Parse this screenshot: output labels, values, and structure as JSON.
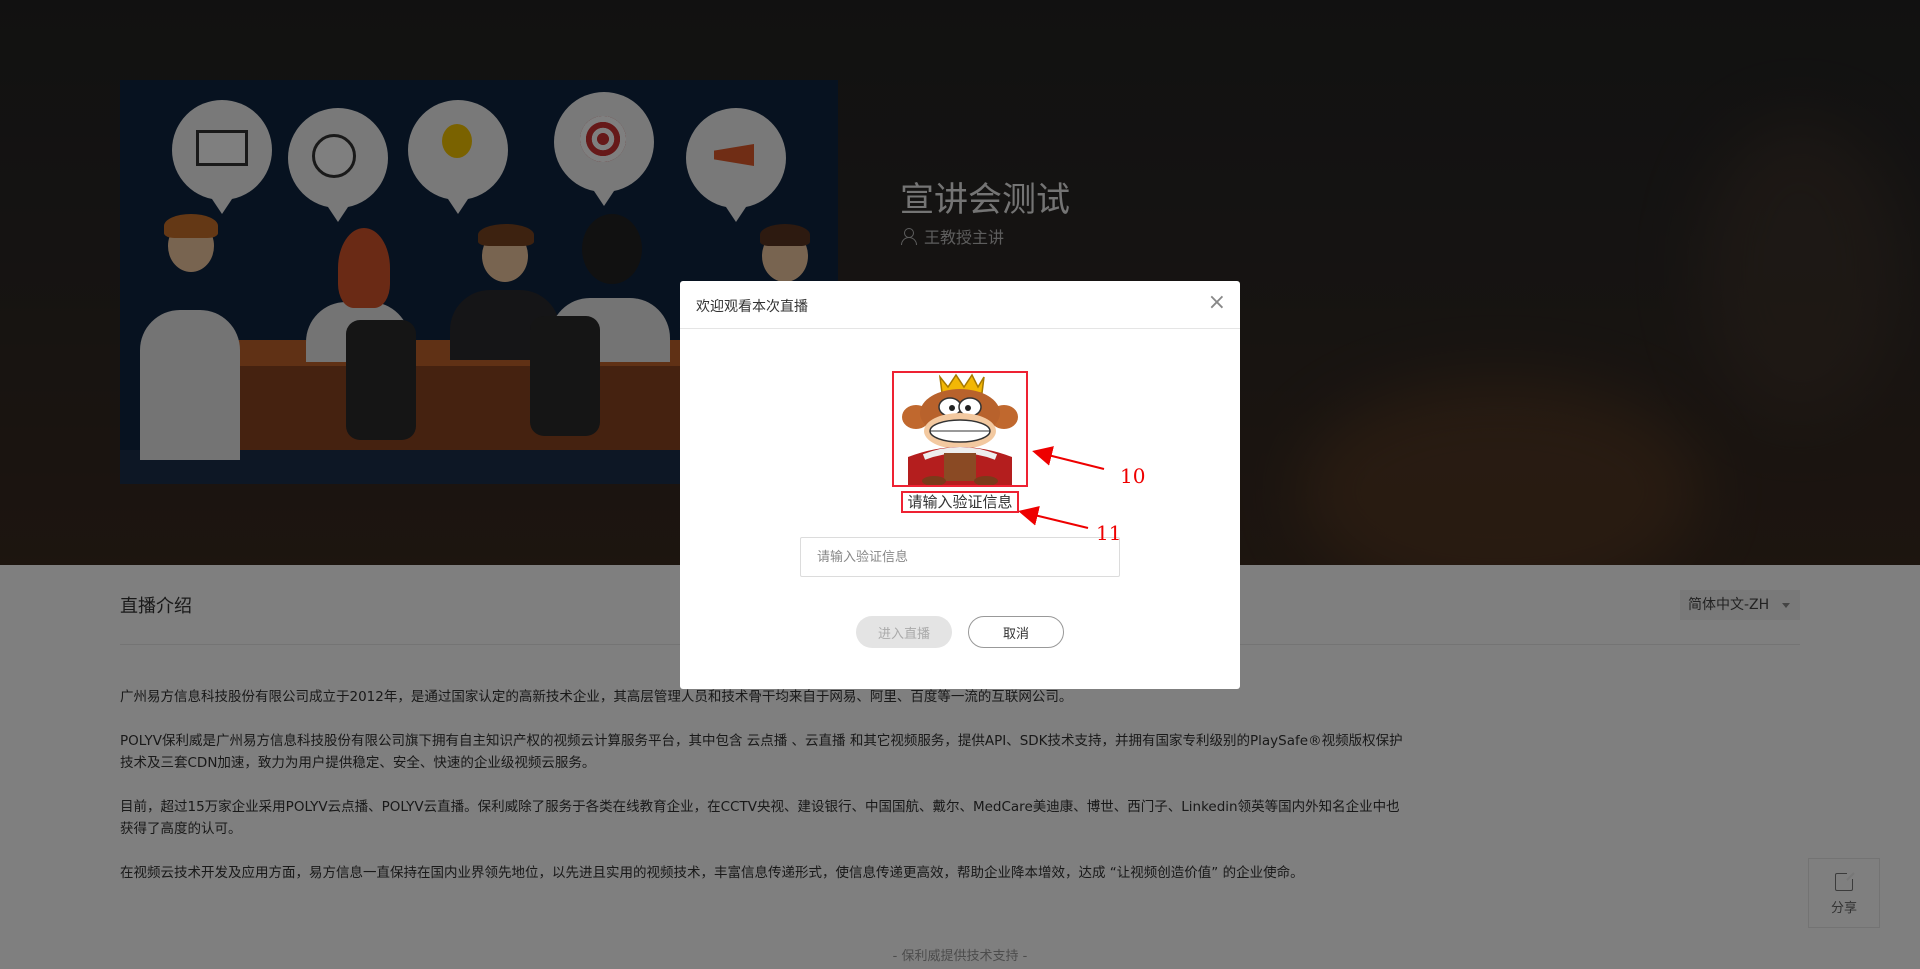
{
  "live": {
    "title": "宣讲会测试",
    "host": "王教授主讲"
  },
  "intro": {
    "section_title": "直播介绍",
    "language": "简体中文-ZH",
    "paragraphs": [
      "广州易方信息科技股份有限公司成立于2012年，是通过国家认定的高新技术企业，其高层管理人员和技术骨干均来自于网易、阿里、百度等一流的互联网公司。",
      "POLYV保利威是广州易方信息科技股份有限公司旗下拥有自主知识产权的视频云计算服务平台，其中包含 云点播 、云直播 和其它视频服务，提供API、SDK技术支持，并拥有国家专利级别的PlaySafe®视频版权保护技术及三套CDN加速，致力为用户提供稳定、安全、快速的企业级视频云服务。",
      "目前，超过15万家企业采用POLYV云点播、POLYV云直播。保利威除了服务于各类在线教育企业，在CCTV央视、建设银行、中国国航、戴尔、MedCare美迪康、博世、西门子、Linkedin领英等国内外知名企业中也获得了高度的认可。",
      "在视频云技术开发及应用方面，易方信息一直保持在国内业界领先地位，以先进且实用的视频技术，丰富信息传递形式，使信息传递更高效，帮助企业降本增效，达成 “让视频创造价值” 的企业使命。"
    ]
  },
  "share": {
    "label": "分享"
  },
  "footer": {
    "text": "- 保利威提供技术支持 -"
  },
  "modal": {
    "title": "欢迎观看本次直播",
    "close": "×",
    "auth_prompt": "请输入验证信息",
    "input_placeholder": "请输入验证信息",
    "input_value": "",
    "enter_button": "进入直播",
    "cancel_button": "取消"
  },
  "annotations": {
    "label_image": "10",
    "label_text": "11"
  },
  "colors": {
    "annotation": "#e00000",
    "disabled_button_bg": "#e4e4e4"
  }
}
